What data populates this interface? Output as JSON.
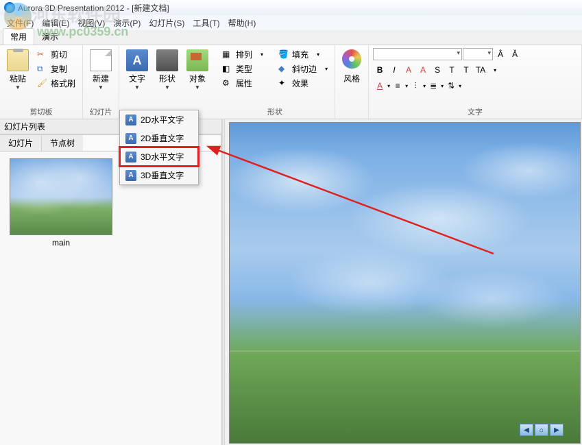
{
  "title": "Aurora 3D Presentation 2012 - [新建文档]",
  "watermark": {
    "text": "河东软件园",
    "url": "www.pc0359.cn"
  },
  "menu": {
    "file": "文件(F)",
    "edit": "编辑(E)",
    "view": "视图(V)",
    "show": "演示(P)",
    "slide": "幻灯片(S)",
    "tool": "工具(T)",
    "help": "帮助(H)"
  },
  "ribbonTabs": {
    "common": "常用",
    "present": "演示"
  },
  "clipboard": {
    "paste": "粘贴",
    "cut": "剪切",
    "copy": "复制",
    "format": "格式刷",
    "group": "剪切板"
  },
  "slideGroup": {
    "new": "新建",
    "group": "幻灯片"
  },
  "textBtn": {
    "label": "文字"
  },
  "shapeBtn": {
    "label": "形状"
  },
  "objBtn": {
    "label": "对象"
  },
  "shapeGroup": {
    "arrange": "排列",
    "type": "类型",
    "prop": "属性",
    "fill": "填充",
    "bevel": "斜切边",
    "effect": "效果",
    "group": "形状"
  },
  "styleGroup": {
    "label": "风格"
  },
  "textGroup": {
    "group": "文字"
  },
  "dropdown": {
    "h2d": "2D水平文字",
    "v2d": "2D垂直文字",
    "h3d": "3D水平文字",
    "v3d": "3D垂直文字"
  },
  "leftPanel": {
    "title": "幻灯片列表",
    "tab1": "幻灯片",
    "tab2": "节点树",
    "thumbLabel": "main"
  },
  "fmt": {
    "B": "B",
    "I": "I",
    "A1": "A",
    "A2": "A",
    "S": "S",
    "T1": "T",
    "T2": "T",
    "TA": "TA"
  }
}
